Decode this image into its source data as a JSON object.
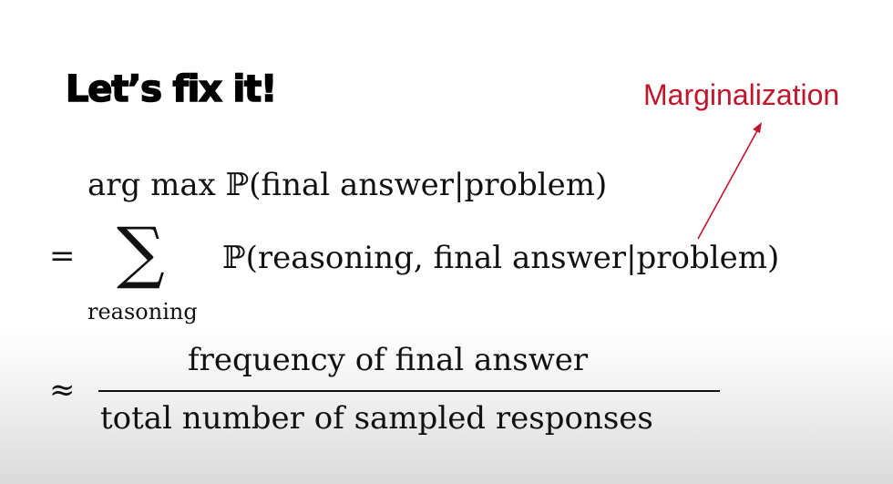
{
  "slide": {
    "title": "Let’s fix it!",
    "annotation": "Marginalization",
    "annotation_color": "#c0152b"
  },
  "math": {
    "line1": "arg max ℙ(final answer|problem)",
    "equals": "=",
    "sigma": "∑",
    "sum_subscript": "reasoning",
    "line2": "ℙ(reasoning, final answer|problem)",
    "approx": "≈",
    "numerator": "frequency of final answer",
    "denominator": "total number of sampled responses"
  }
}
